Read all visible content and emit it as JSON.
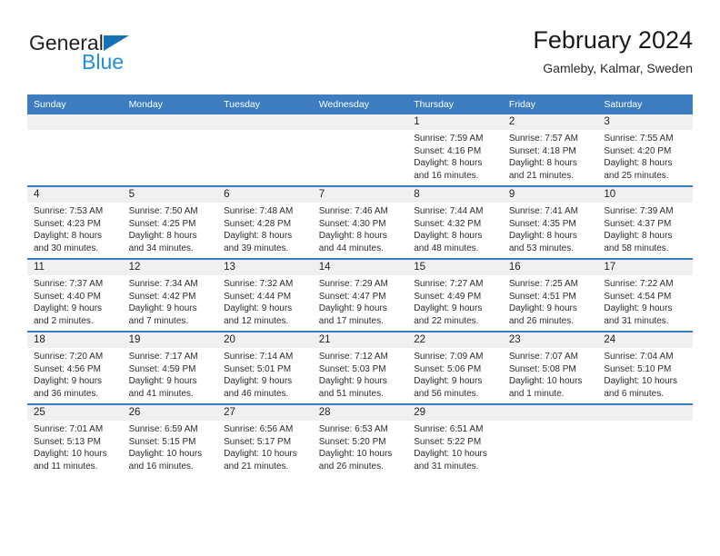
{
  "brand": {
    "name_top": "General",
    "name_bottom": "Blue",
    "triangle_color": "#1672b8",
    "blue_text_color": "#1f8fd8"
  },
  "header": {
    "title": "February 2024",
    "subtitle": "Gamleby, Kalmar, Sweden"
  },
  "theme": {
    "header_bar_color": "#3c7cbf",
    "daynum_band_color": "#f0f0f0",
    "row_divider_color": "#3c7cbf"
  },
  "weekdays": [
    "Sunday",
    "Monday",
    "Tuesday",
    "Wednesday",
    "Thursday",
    "Friday",
    "Saturday"
  ],
  "weeks": [
    [
      {
        "day": "",
        "empty": true,
        "sunrise": "",
        "sunset": "",
        "daylight_line1": "",
        "daylight_line2": ""
      },
      {
        "day": "",
        "empty": true,
        "sunrise": "",
        "sunset": "",
        "daylight_line1": "",
        "daylight_line2": ""
      },
      {
        "day": "",
        "empty": true,
        "sunrise": "",
        "sunset": "",
        "daylight_line1": "",
        "daylight_line2": ""
      },
      {
        "day": "",
        "empty": true,
        "sunrise": "",
        "sunset": "",
        "daylight_line1": "",
        "daylight_line2": ""
      },
      {
        "day": "1",
        "empty": false,
        "sunrise": "Sunrise: 7:59 AM",
        "sunset": "Sunset: 4:16 PM",
        "daylight_line1": "Daylight: 8 hours",
        "daylight_line2": "and 16 minutes."
      },
      {
        "day": "2",
        "empty": false,
        "sunrise": "Sunrise: 7:57 AM",
        "sunset": "Sunset: 4:18 PM",
        "daylight_line1": "Daylight: 8 hours",
        "daylight_line2": "and 21 minutes."
      },
      {
        "day": "3",
        "empty": false,
        "sunrise": "Sunrise: 7:55 AM",
        "sunset": "Sunset: 4:20 PM",
        "daylight_line1": "Daylight: 8 hours",
        "daylight_line2": "and 25 minutes."
      }
    ],
    [
      {
        "day": "4",
        "empty": false,
        "sunrise": "Sunrise: 7:53 AM",
        "sunset": "Sunset: 4:23 PM",
        "daylight_line1": "Daylight: 8 hours",
        "daylight_line2": "and 30 minutes."
      },
      {
        "day": "5",
        "empty": false,
        "sunrise": "Sunrise: 7:50 AM",
        "sunset": "Sunset: 4:25 PM",
        "daylight_line1": "Daylight: 8 hours",
        "daylight_line2": "and 34 minutes."
      },
      {
        "day": "6",
        "empty": false,
        "sunrise": "Sunrise: 7:48 AM",
        "sunset": "Sunset: 4:28 PM",
        "daylight_line1": "Daylight: 8 hours",
        "daylight_line2": "and 39 minutes."
      },
      {
        "day": "7",
        "empty": false,
        "sunrise": "Sunrise: 7:46 AM",
        "sunset": "Sunset: 4:30 PM",
        "daylight_line1": "Daylight: 8 hours",
        "daylight_line2": "and 44 minutes."
      },
      {
        "day": "8",
        "empty": false,
        "sunrise": "Sunrise: 7:44 AM",
        "sunset": "Sunset: 4:32 PM",
        "daylight_line1": "Daylight: 8 hours",
        "daylight_line2": "and 48 minutes."
      },
      {
        "day": "9",
        "empty": false,
        "sunrise": "Sunrise: 7:41 AM",
        "sunset": "Sunset: 4:35 PM",
        "daylight_line1": "Daylight: 8 hours",
        "daylight_line2": "and 53 minutes."
      },
      {
        "day": "10",
        "empty": false,
        "sunrise": "Sunrise: 7:39 AM",
        "sunset": "Sunset: 4:37 PM",
        "daylight_line1": "Daylight: 8 hours",
        "daylight_line2": "and 58 minutes."
      }
    ],
    [
      {
        "day": "11",
        "empty": false,
        "sunrise": "Sunrise: 7:37 AM",
        "sunset": "Sunset: 4:40 PM",
        "daylight_line1": "Daylight: 9 hours",
        "daylight_line2": "and 2 minutes."
      },
      {
        "day": "12",
        "empty": false,
        "sunrise": "Sunrise: 7:34 AM",
        "sunset": "Sunset: 4:42 PM",
        "daylight_line1": "Daylight: 9 hours",
        "daylight_line2": "and 7 minutes."
      },
      {
        "day": "13",
        "empty": false,
        "sunrise": "Sunrise: 7:32 AM",
        "sunset": "Sunset: 4:44 PM",
        "daylight_line1": "Daylight: 9 hours",
        "daylight_line2": "and 12 minutes."
      },
      {
        "day": "14",
        "empty": false,
        "sunrise": "Sunrise: 7:29 AM",
        "sunset": "Sunset: 4:47 PM",
        "daylight_line1": "Daylight: 9 hours",
        "daylight_line2": "and 17 minutes."
      },
      {
        "day": "15",
        "empty": false,
        "sunrise": "Sunrise: 7:27 AM",
        "sunset": "Sunset: 4:49 PM",
        "daylight_line1": "Daylight: 9 hours",
        "daylight_line2": "and 22 minutes."
      },
      {
        "day": "16",
        "empty": false,
        "sunrise": "Sunrise: 7:25 AM",
        "sunset": "Sunset: 4:51 PM",
        "daylight_line1": "Daylight: 9 hours",
        "daylight_line2": "and 26 minutes."
      },
      {
        "day": "17",
        "empty": false,
        "sunrise": "Sunrise: 7:22 AM",
        "sunset": "Sunset: 4:54 PM",
        "daylight_line1": "Daylight: 9 hours",
        "daylight_line2": "and 31 minutes."
      }
    ],
    [
      {
        "day": "18",
        "empty": false,
        "sunrise": "Sunrise: 7:20 AM",
        "sunset": "Sunset: 4:56 PM",
        "daylight_line1": "Daylight: 9 hours",
        "daylight_line2": "and 36 minutes."
      },
      {
        "day": "19",
        "empty": false,
        "sunrise": "Sunrise: 7:17 AM",
        "sunset": "Sunset: 4:59 PM",
        "daylight_line1": "Daylight: 9 hours",
        "daylight_line2": "and 41 minutes."
      },
      {
        "day": "20",
        "empty": false,
        "sunrise": "Sunrise: 7:14 AM",
        "sunset": "Sunset: 5:01 PM",
        "daylight_line1": "Daylight: 9 hours",
        "daylight_line2": "and 46 minutes."
      },
      {
        "day": "21",
        "empty": false,
        "sunrise": "Sunrise: 7:12 AM",
        "sunset": "Sunset: 5:03 PM",
        "daylight_line1": "Daylight: 9 hours",
        "daylight_line2": "and 51 minutes."
      },
      {
        "day": "22",
        "empty": false,
        "sunrise": "Sunrise: 7:09 AM",
        "sunset": "Sunset: 5:06 PM",
        "daylight_line1": "Daylight: 9 hours",
        "daylight_line2": "and 56 minutes."
      },
      {
        "day": "23",
        "empty": false,
        "sunrise": "Sunrise: 7:07 AM",
        "sunset": "Sunset: 5:08 PM",
        "daylight_line1": "Daylight: 10 hours",
        "daylight_line2": "and 1 minute."
      },
      {
        "day": "24",
        "empty": false,
        "sunrise": "Sunrise: 7:04 AM",
        "sunset": "Sunset: 5:10 PM",
        "daylight_line1": "Daylight: 10 hours",
        "daylight_line2": "and 6 minutes."
      }
    ],
    [
      {
        "day": "25",
        "empty": false,
        "sunrise": "Sunrise: 7:01 AM",
        "sunset": "Sunset: 5:13 PM",
        "daylight_line1": "Daylight: 10 hours",
        "daylight_line2": "and 11 minutes."
      },
      {
        "day": "26",
        "empty": false,
        "sunrise": "Sunrise: 6:59 AM",
        "sunset": "Sunset: 5:15 PM",
        "daylight_line1": "Daylight: 10 hours",
        "daylight_line2": "and 16 minutes."
      },
      {
        "day": "27",
        "empty": false,
        "sunrise": "Sunrise: 6:56 AM",
        "sunset": "Sunset: 5:17 PM",
        "daylight_line1": "Daylight: 10 hours",
        "daylight_line2": "and 21 minutes."
      },
      {
        "day": "28",
        "empty": false,
        "sunrise": "Sunrise: 6:53 AM",
        "sunset": "Sunset: 5:20 PM",
        "daylight_line1": "Daylight: 10 hours",
        "daylight_line2": "and 26 minutes."
      },
      {
        "day": "29",
        "empty": false,
        "sunrise": "Sunrise: 6:51 AM",
        "sunset": "Sunset: 5:22 PM",
        "daylight_line1": "Daylight: 10 hours",
        "daylight_line2": "and 31 minutes."
      },
      {
        "day": "",
        "empty": true,
        "sunrise": "",
        "sunset": "",
        "daylight_line1": "",
        "daylight_line2": ""
      },
      {
        "day": "",
        "empty": true,
        "sunrise": "",
        "sunset": "",
        "daylight_line1": "",
        "daylight_line2": ""
      }
    ]
  ]
}
